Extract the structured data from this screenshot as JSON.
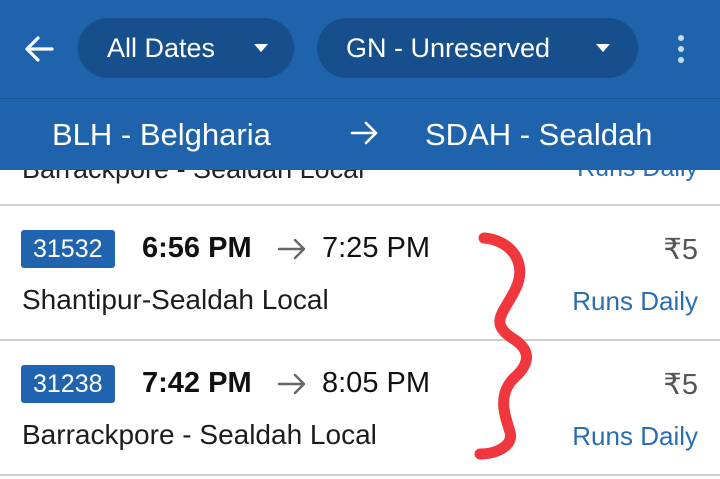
{
  "header": {
    "date_filter": "All Dates",
    "class_filter": "GN - Unreserved",
    "icons": {
      "back": "arrow-left-icon",
      "date_caret": "caret-down-icon",
      "class_caret": "caret-down-icon",
      "more": "more-vertical-icon"
    }
  },
  "route": {
    "from": "BLH - Belgharia",
    "to": "SDAH - Sealdah",
    "arrow_icon": "arrow-right-icon"
  },
  "partial_row": {
    "name": "Barrackpore - Sealdah Local",
    "frequency": "Runs Daily"
  },
  "trains": [
    {
      "number": "31532",
      "departure": "6:56 PM",
      "arrival": "7:25 PM",
      "fare": "₹5",
      "name": "Shantipur-Sealdah Local",
      "frequency": "Runs Daily"
    },
    {
      "number": "31238",
      "departure": "7:42 PM",
      "arrival": "8:05 PM",
      "fare": "₹5",
      "name": "Barrackpore - Sealdah Local",
      "frequency": "Runs Daily"
    }
  ],
  "colors": {
    "header_bg": "#1f63ad",
    "pill_bg": "#164f8c",
    "badge_bg": "#2064b0",
    "frequency_text": "#2a6db2",
    "annotation": "#f0373d"
  }
}
